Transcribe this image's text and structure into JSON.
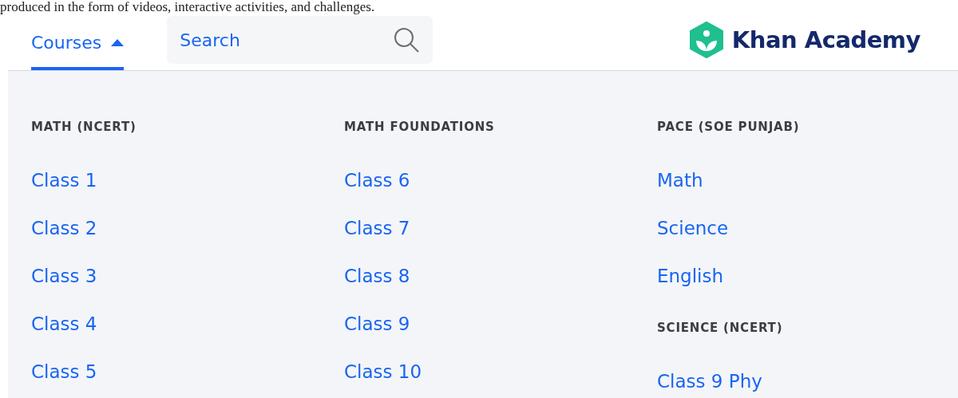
{
  "page_text": "produced in the form of videos, interactive activities, and challenges.",
  "nav": {
    "courses": {
      "label": "Courses",
      "selected": true,
      "expanded": true
    },
    "search": {
      "placeholder": "Search"
    },
    "logo": {
      "text": "Khan Academy"
    }
  },
  "menu": {
    "columns": [
      {
        "groups": [
          {
            "title": "MATH (NCERT)",
            "items": [
              "Class 1",
              "Class 2",
              "Class 3",
              "Class 4",
              "Class 5"
            ]
          }
        ]
      },
      {
        "groups": [
          {
            "title": "MATH FOUNDATIONS",
            "items": [
              "Class 6",
              "Class 7",
              "Class 8",
              "Class 9",
              "Class 10"
            ]
          }
        ]
      },
      {
        "groups": [
          {
            "title": "PACE (SOE PUNJAB)",
            "items": [
              "Math",
              "Science",
              "English"
            ]
          },
          {
            "title": "SCIENCE (NCERT)",
            "items": [
              "Class 9 Phy"
            ]
          }
        ]
      }
    ]
  }
}
